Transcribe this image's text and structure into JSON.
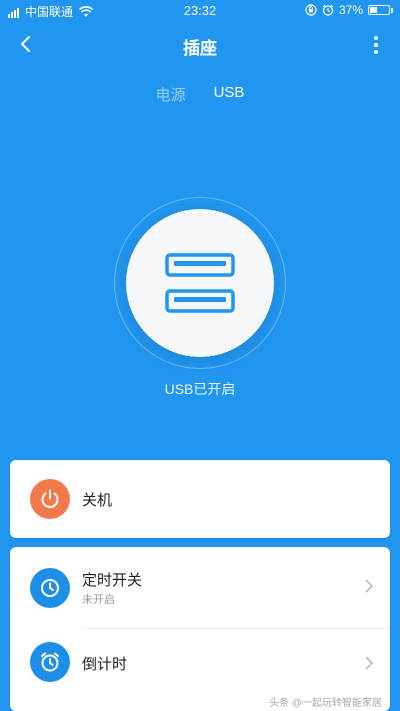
{
  "status_bar": {
    "carrier": "中国联通",
    "time": "23:32",
    "battery_percent": "37%",
    "battery_level": 0.37
  },
  "header": {
    "title": "插座"
  },
  "tabs": [
    {
      "label": "电源",
      "active": false
    },
    {
      "label": "USB",
      "active": true
    }
  ],
  "usb": {
    "status_text": "USB已开启"
  },
  "power_card": {
    "title": "关机",
    "icon_color": "#F27A4A"
  },
  "schedule_card": {
    "timer_title": "定时开关",
    "timer_subtitle": "未开启",
    "countdown_title": "倒计时",
    "icon_color": "#1E8FE8"
  },
  "watermark": "头条 @一起玩转智能家居",
  "colors": {
    "background": "#2196F0",
    "card": "#FFFFFF"
  }
}
